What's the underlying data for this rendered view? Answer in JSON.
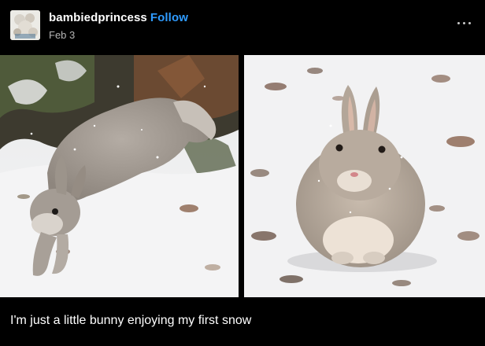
{
  "post": {
    "username": "bambiedprincess",
    "follow_label": "Follow",
    "date": "Feb 3",
    "caption": "I'm just a little bunny enjoying my first snow",
    "more_icon": "more-horizontal-icon",
    "photos": [
      {
        "name": "bunny-jumping-photo"
      },
      {
        "name": "bunny-sitting-photo"
      }
    ]
  },
  "colors": {
    "background": "#000000",
    "follow_accent": "#2f9bff",
    "date_text": "#b5b5b5",
    "snow": "#f3f3f4",
    "bunny_fur": "#a9a19a"
  }
}
